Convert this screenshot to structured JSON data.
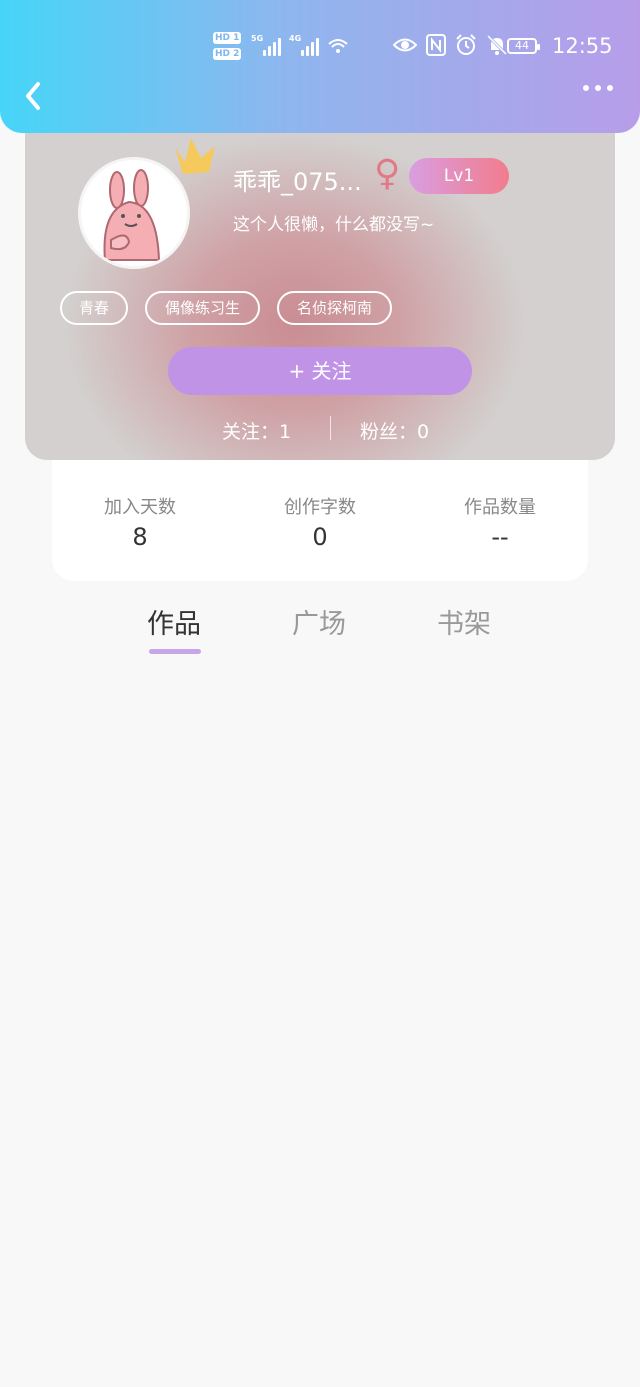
{
  "status_bar": {
    "hd1": "HD 1",
    "hd2": "HD 2",
    "net1": "5G",
    "net2": "4G",
    "battery": "44",
    "time": "12:55"
  },
  "profile": {
    "name": "乖乖_075...",
    "gender_symbol": "♀",
    "level": "Lv1",
    "bio": "这个人很懒，什么都没写~",
    "tags": [
      "青春",
      "偶像练习生",
      "名侦探柯南"
    ],
    "follow_label": "+   关注",
    "following": "关注：1",
    "fans": "粉丝：0"
  },
  "stats": [
    {
      "label": "加入天数",
      "value": "8"
    },
    {
      "label": "创作字数",
      "value": "0"
    },
    {
      "label": "作品数量",
      "value": "--"
    }
  ],
  "tabs": [
    "作品",
    "广场",
    "书架"
  ],
  "colors": {
    "header_start": "#46d5f8",
    "header_end": "#b79de9",
    "follow_button": "#c093e7",
    "level_badge_start": "#d99ee1",
    "level_badge_end": "#f27c8d",
    "gender": "#e07a87",
    "tab_indicator": "#c7a6e8"
  }
}
